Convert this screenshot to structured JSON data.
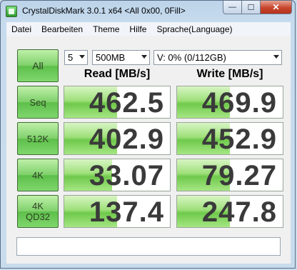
{
  "window": {
    "title": "CrystalDiskMark 3.0.1 x64 <All 0x00, 0Fill>",
    "minimize": "—",
    "maximize": "☐",
    "close": "✕"
  },
  "menu": [
    "Datei",
    "Bearbeiten",
    "Theme",
    "Hilfe",
    "Sprache(Language)"
  ],
  "controls": {
    "all_label": "All",
    "count": "5",
    "size": "500MB",
    "drive": "V: 0% (0/112GB)"
  },
  "headers": {
    "read": "Read [MB/s]",
    "write": "Write [MB/s]"
  },
  "rows": [
    {
      "label_line1": "Seq",
      "label_line2": "",
      "read": "462.5",
      "write": "469.9",
      "read_fill": 0.5,
      "write_fill": 0.5
    },
    {
      "label_line1": "512K",
      "label_line2": "",
      "read": "402.9",
      "write": "452.9",
      "read_fill": 0.5,
      "write_fill": 0.5
    },
    {
      "label_line1": "4K",
      "label_line2": "",
      "read": "33.07",
      "write": "79.27",
      "read_fill": 0.45,
      "write_fill": 0.5
    },
    {
      "label_line1": "4K",
      "label_line2": "QD32",
      "read": "137.4",
      "write": "247.8",
      "read_fill": 0.5,
      "write_fill": 0.5
    }
  ],
  "status": ""
}
